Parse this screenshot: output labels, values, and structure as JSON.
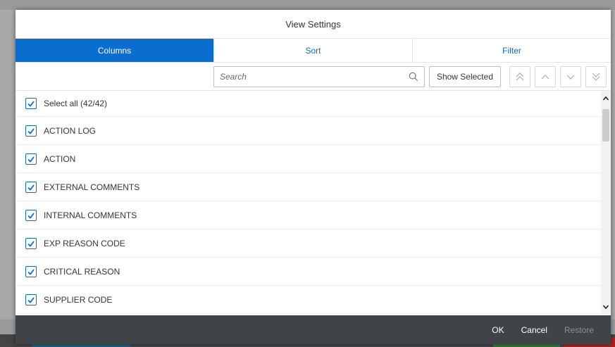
{
  "dialog": {
    "title": "View Settings",
    "tabs": [
      {
        "label": "Columns",
        "active": true
      },
      {
        "label": "Sort",
        "active": false
      },
      {
        "label": "Filter",
        "active": false
      }
    ],
    "toolbar": {
      "search_placeholder": "Search",
      "show_selected_label": "Show Selected",
      "icons": [
        "double-chevron-up-icon",
        "chevron-up-icon",
        "chevron-down-icon",
        "double-chevron-down-icon"
      ]
    },
    "items": [
      {
        "label": "Select all (42/42)",
        "checked": true
      },
      {
        "label": "ACTION LOG",
        "checked": true
      },
      {
        "label": "ACTION",
        "checked": true
      },
      {
        "label": "EXTERNAL COMMENTS",
        "checked": true
      },
      {
        "label": "INTERNAL COMMENTS",
        "checked": true
      },
      {
        "label": "EXP REASON CODE",
        "checked": true
      },
      {
        "label": "CRITICAL REASON",
        "checked": true
      },
      {
        "label": "SUPPLIER CODE",
        "checked": true
      }
    ],
    "footer": {
      "ok_label": "OK",
      "cancel_label": "Cancel",
      "restore_label": "Restore"
    }
  },
  "colors": {
    "accent": "#0a6ed1",
    "footer_bg": "#3f4448"
  }
}
